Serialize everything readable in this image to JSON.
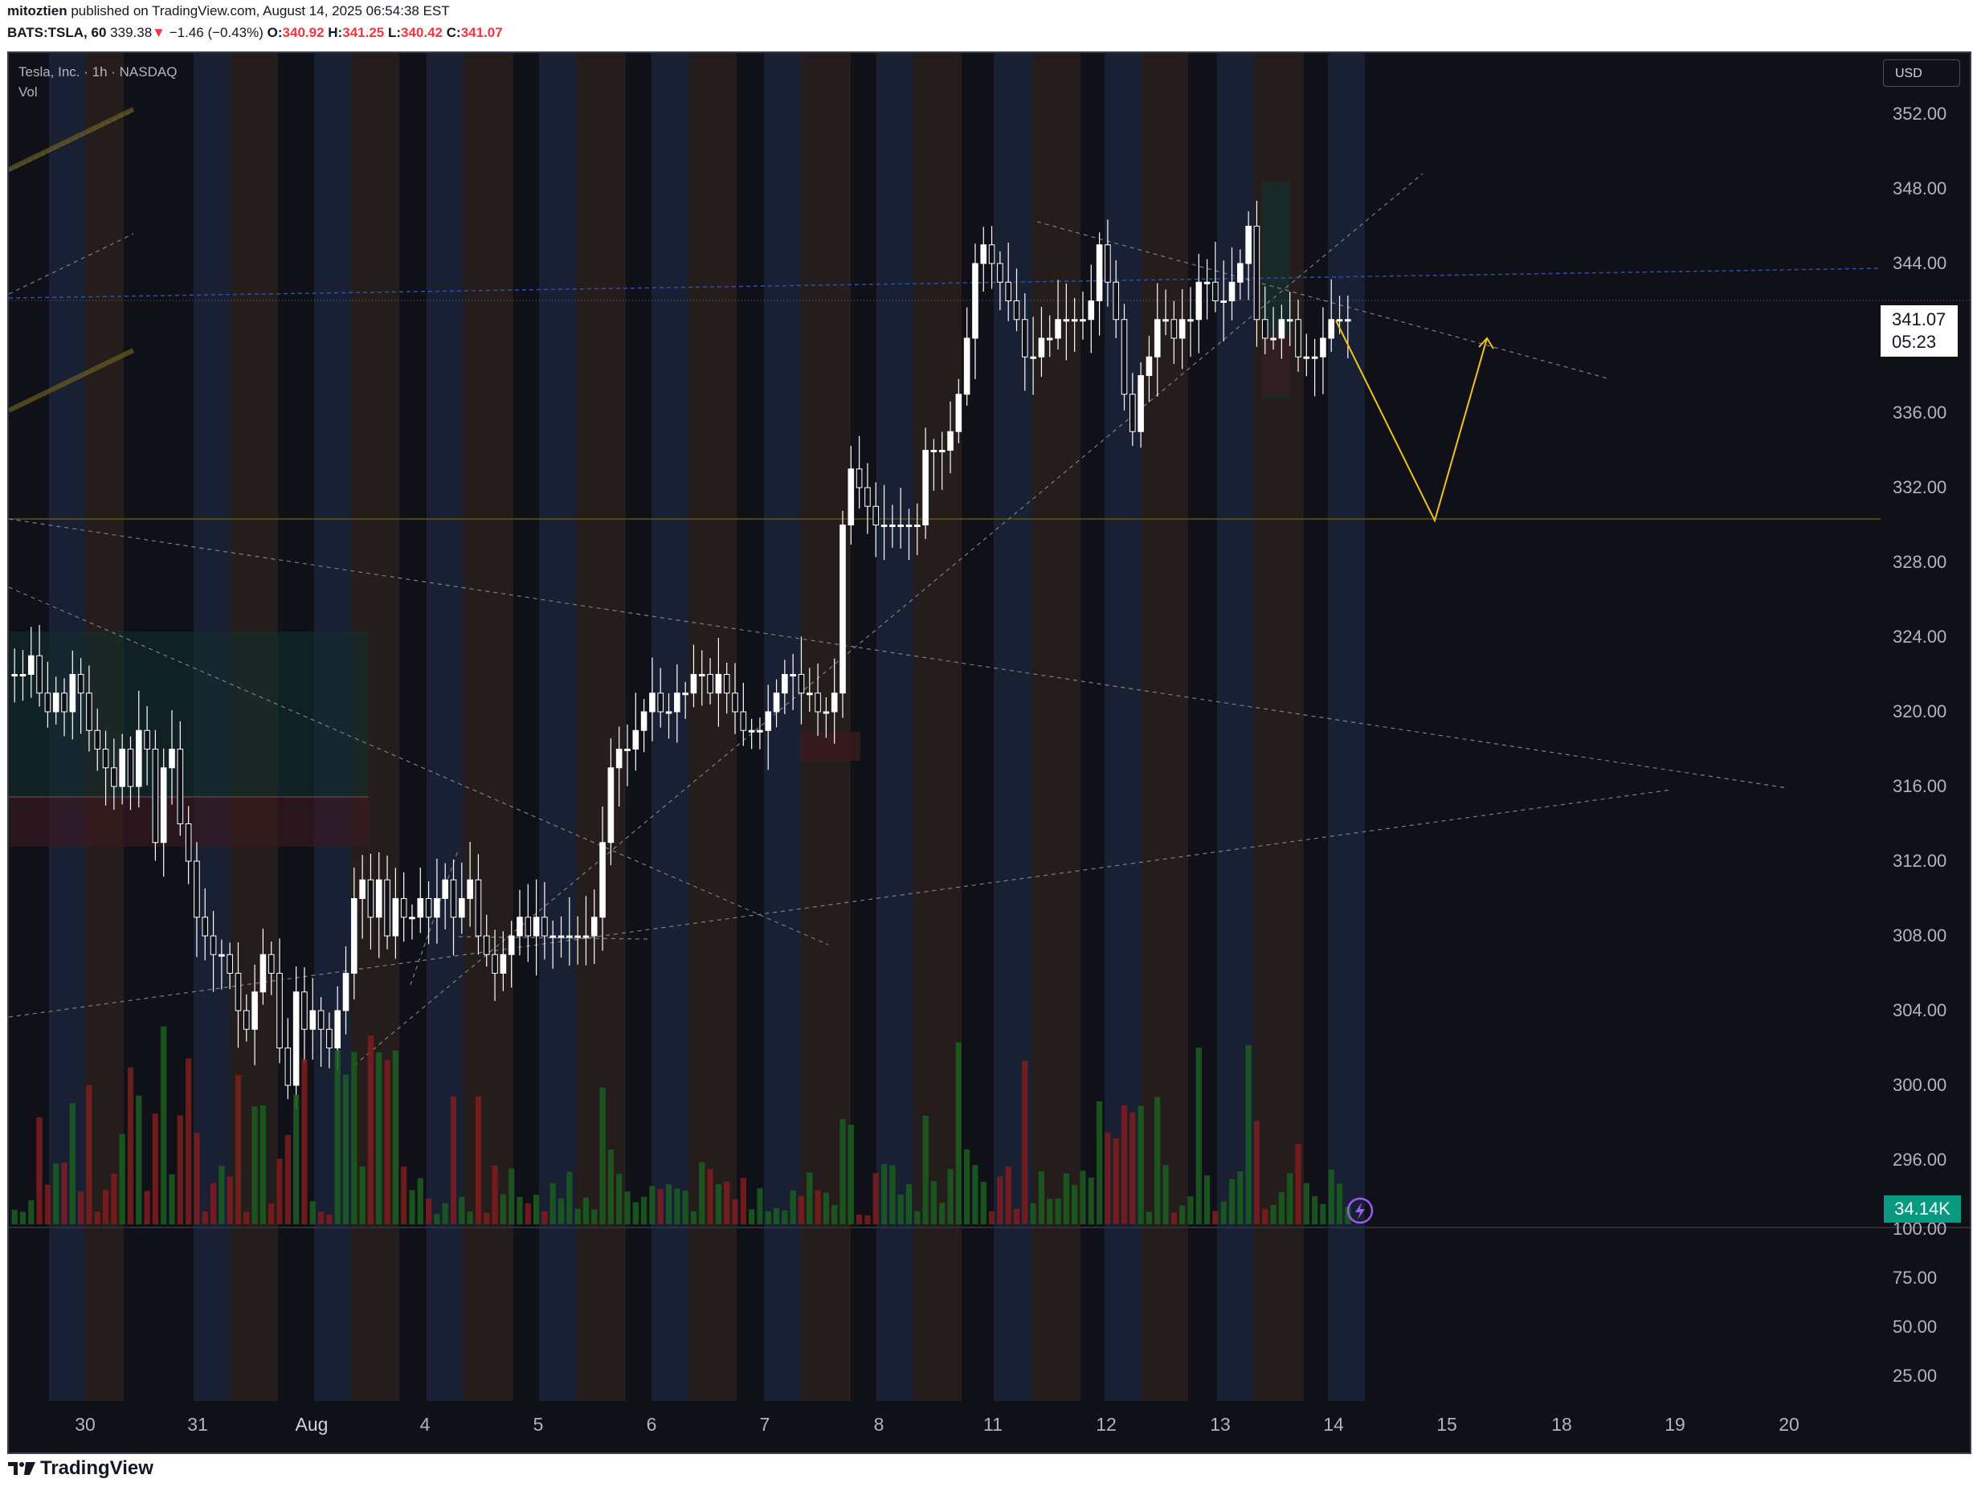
{
  "header": {
    "publisher": "mitoztien",
    "published_text": "published on TradingView.com, August 14, 2025 06:54:38 EST",
    "symbol": "BATS:TSLA, 60",
    "last": "339.38",
    "arrow": "▼",
    "change": "−1.46 (−0.43%)",
    "o_label": "O:",
    "o_value": "340.92",
    "h_label": "H:",
    "h_value": "341.25",
    "l_label": "L:",
    "l_value": "340.42",
    "c_label": "C:",
    "c_value": "341.07"
  },
  "legend": {
    "title": "Tesla, Inc. · 1h · NASDAQ",
    "vol": "Vol"
  },
  "currency_button": "USD",
  "price_axis": [
    "352.00",
    "348.00",
    "344.00",
    "340.00",
    "336.00",
    "332.00",
    "328.00",
    "324.00",
    "320.00",
    "316.00",
    "312.00",
    "308.00",
    "304.00",
    "300.00",
    "296.00"
  ],
  "osc_axis": [
    "100.00",
    "75.00",
    "50.00",
    "25.00"
  ],
  "time_axis": [
    "30",
    "31",
    "Aug",
    "4",
    "5",
    "6",
    "7",
    "8",
    "11",
    "12",
    "13",
    "14",
    "15",
    "18",
    "19",
    "20"
  ],
  "current_price": "341.07",
  "countdown": "05:23",
  "volume_label": "34.14K",
  "footer_logo": "TradingView",
  "colors": {
    "up": "#ffffff",
    "down": "#ffffff",
    "vol_up": "#1b5e20",
    "vol_down": "#7f1d1d",
    "price_box": "#ffffff",
    "vol_box": "#089981",
    "projection": "#f0c419"
  },
  "chart_data": {
    "type": "candlestick",
    "symbol": "TSLA",
    "interval": "1h",
    "ylim": [
      294,
      354
    ],
    "dates": [
      "30",
      "31",
      "Aug",
      "4",
      "5",
      "6",
      "7",
      "8",
      "11",
      "12",
      "13",
      "14"
    ],
    "day_closes": [
      319.5,
      312.5,
      300.5,
      309.0,
      307.0,
      320.5,
      318.5,
      330.0,
      339.0,
      342.0,
      339.5,
      341.07
    ],
    "projection": [
      {
        "date": "14",
        "price": 341.07
      },
      {
        "date": "15",
        "price": 330.0
      },
      {
        "date": "15",
        "price": 340.0
      }
    ],
    "levels": [
      {
        "price": 343.0,
        "style": "dotted-blue"
      },
      {
        "price": 330.0,
        "style": "solid-yellow"
      }
    ]
  }
}
